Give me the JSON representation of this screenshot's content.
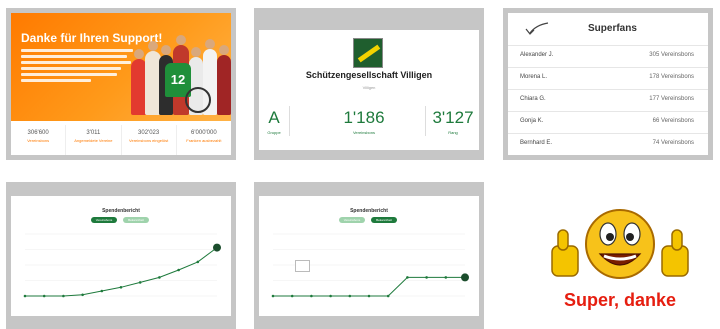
{
  "promo": {
    "title": "Danke für Ihren Support!",
    "jersey_number": "12",
    "stats": [
      {
        "value": "306'600",
        "label": "Vereinsbons"
      },
      {
        "value": "3'011",
        "label": "Angemeldete Vereine"
      },
      {
        "value": "302'023",
        "label": "Vereinsbons eingelöst"
      },
      {
        "value": "6'000'000",
        "label": "Franken ausbezahlt"
      }
    ]
  },
  "club": {
    "name": "Schützengesellschaft Villigen",
    "subtitle": "Villigen",
    "kpis": [
      {
        "value": "A",
        "label": "Gruppe"
      },
      {
        "value": "1'186",
        "label": "Vereinsbons"
      },
      {
        "value": "3'127",
        "label": "Rang"
      }
    ]
  },
  "superfans": {
    "title": "Superfans",
    "rows": [
      {
        "name": "Alexander J.",
        "count": "305 Vereinsbons"
      },
      {
        "name": "Morena L.",
        "count": "178 Vereinsbons"
      },
      {
        "name": "Chiara G.",
        "count": "177 Vereinsbons"
      },
      {
        "name": "Gonja K.",
        "count": "66 Vereinsbons"
      },
      {
        "name": "Bernhard E.",
        "count": "74 Vereinsbons"
      }
    ]
  },
  "chart_left": {
    "title": "Spendenbericht",
    "buttons": [
      "Vereinsbons",
      "Bekanntheit"
    ]
  },
  "chart_right": {
    "title": "Spendenbericht",
    "buttons": [
      "Vereinsbons",
      "Bekanntheit"
    ]
  },
  "chart_data": [
    {
      "type": "line",
      "x": [
        1,
        2,
        3,
        4,
        5,
        6,
        7,
        8,
        9,
        10,
        11
      ],
      "series": [
        {
          "values": [
            0,
            0,
            0,
            2,
            8,
            14,
            22,
            30,
            42,
            55,
            78
          ]
        }
      ],
      "ylim": [
        0,
        100
      ]
    },
    {
      "type": "line",
      "x": [
        1,
        2,
        3,
        4,
        5,
        6,
        7,
        8,
        9,
        10
      ],
      "series": [
        {
          "values": [
            0,
            0,
            0,
            0,
            0,
            0,
            0,
            30,
            30,
            30,
            30
          ]
        }
      ],
      "ylim": [
        0,
        100
      ]
    }
  ],
  "emoji": {
    "caption": "Super, danke"
  },
  "colors": {
    "orange": "#ff7a00",
    "green": "#1e7a3c",
    "light_green": "#9fd3ac",
    "red_text": "#e61e10"
  }
}
